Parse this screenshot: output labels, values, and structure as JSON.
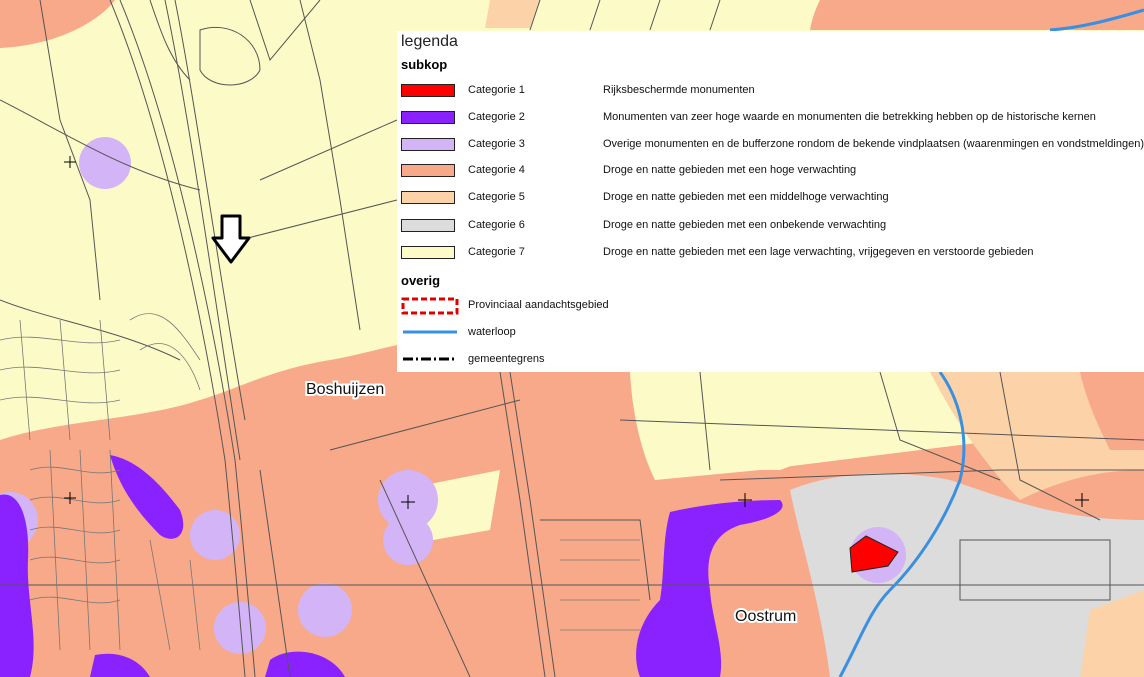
{
  "legend": {
    "title": "legenda",
    "subheading": "subkop",
    "categories": [
      {
        "label": "Categorie 1",
        "description": "Rijksbeschermde monumenten",
        "color": "#ff0000"
      },
      {
        "label": "Categorie 2",
        "description": "Monumenten van zeer hoge waarde en monumenten die betrekking hebben op de historische kernen",
        "color": "#8a22ff"
      },
      {
        "label": "Categorie 3",
        "description": "Overige monumenten en de bufferzone rondom de bekende vindplaatsen (waarenmingen en vondstmeldingen)",
        "color": "#d2b4f7"
      },
      {
        "label": "Categorie 4",
        "description": "Droge en natte gebieden met een hoge verwachting",
        "color": "#f8a98a"
      },
      {
        "label": "Categorie 5",
        "description": "Droge en natte gebieden met een middelhoge verwachting",
        "color": "#fcd2a8"
      },
      {
        "label": "Categorie 6",
        "description": "Droge en natte gebieden met een onbekende verwachting",
        "color": "#dcdcdc"
      },
      {
        "label": "Categorie 7",
        "description": "Droge en natte gebieden met een lage verwachting, vrijgegeven en verstoorde gebieden",
        "color": "#fcfbc8"
      }
    ],
    "other_heading": "overig",
    "other": [
      {
        "label": "Provinciaal aandachtsgebied",
        "symbol": "red-dashed-outline",
        "color": "#e00000"
      },
      {
        "label": "waterloop",
        "symbol": "blue-line",
        "color": "#3a8fe0"
      },
      {
        "label": "gemeentegrens",
        "symbol": "dash-dot-line",
        "color": "#000000"
      }
    ]
  },
  "places": [
    {
      "name": "Boshuijzen"
    },
    {
      "name": "Oostrum"
    }
  ],
  "markers": [
    {
      "name": "location-arrow-icon"
    }
  ]
}
